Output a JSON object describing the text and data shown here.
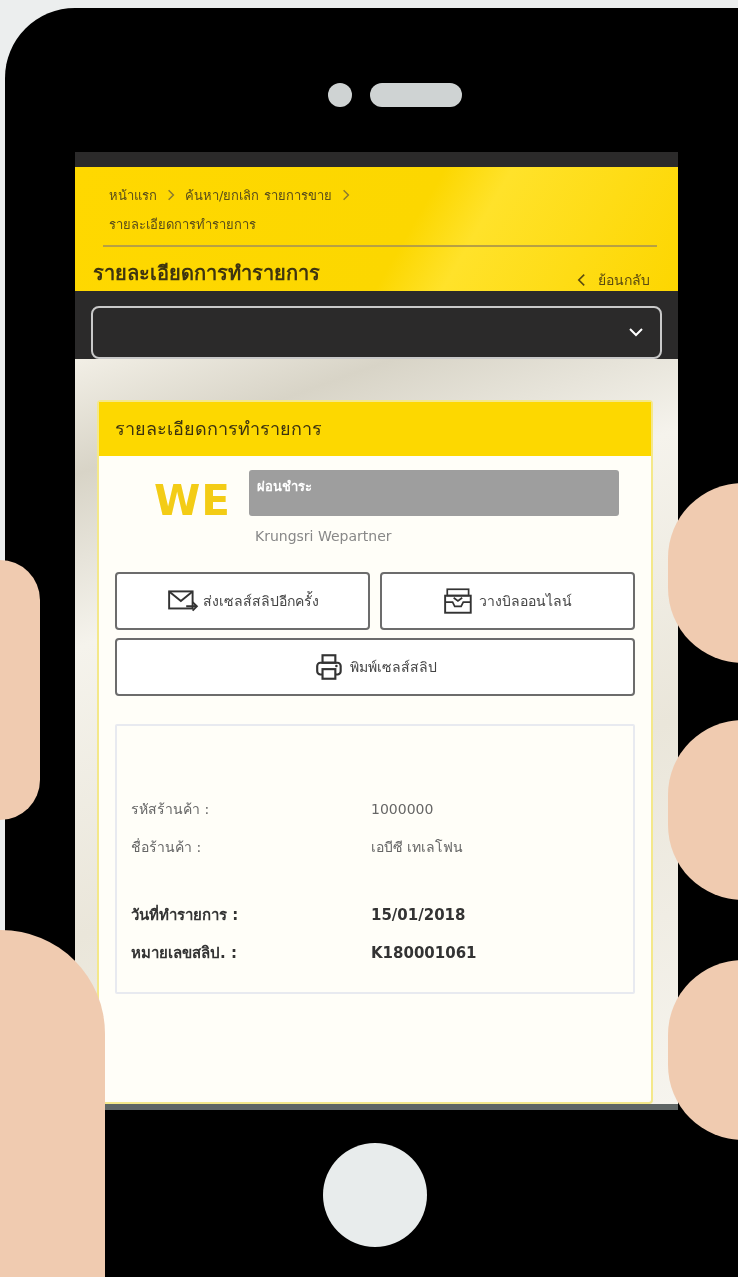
{
  "breadcrumb": [
    {
      "label": "หน้าแรก"
    },
    {
      "label": "ค้นหา/ยกเลิก รายการขาย"
    },
    {
      "label": "รายละเอียดการทำรายการ"
    }
  ],
  "header": {
    "title": "รายละเอียดการทำรายการ",
    "back": "ย้อนกลับ"
  },
  "card": {
    "title": "รายละเอียดการทำรายการ",
    "logo": "WE",
    "badge": "ผ่อนชำระ",
    "merchant_brand": "Krungsri Wepartner",
    "buttons": [
      {
        "label": "ส่งเซลส์สลิปอีกครั้ง",
        "kind": "mail"
      },
      {
        "label": "วางบิลออนไลน์",
        "kind": "inbox"
      },
      {
        "label": "พิมพ์เซลส์สลิป",
        "kind": "print"
      }
    ],
    "groups": [
      [
        {
          "label": "รหัสร้านค้า :",
          "value": "1000000",
          "kind": "plain"
        },
        {
          "label": "ชื่อร้านค้า :",
          "value": "เอบีซี เทเลโฟน",
          "kind": "plain"
        }
      ],
      [
        {
          "label": "วันที่ทำรายการ :",
          "value": "15/01/2018",
          "kind": "bold"
        },
        {
          "label": "หมายเลขสลิป. :",
          "value": "K180001061",
          "kind": "bold"
        }
      ]
    ]
  }
}
